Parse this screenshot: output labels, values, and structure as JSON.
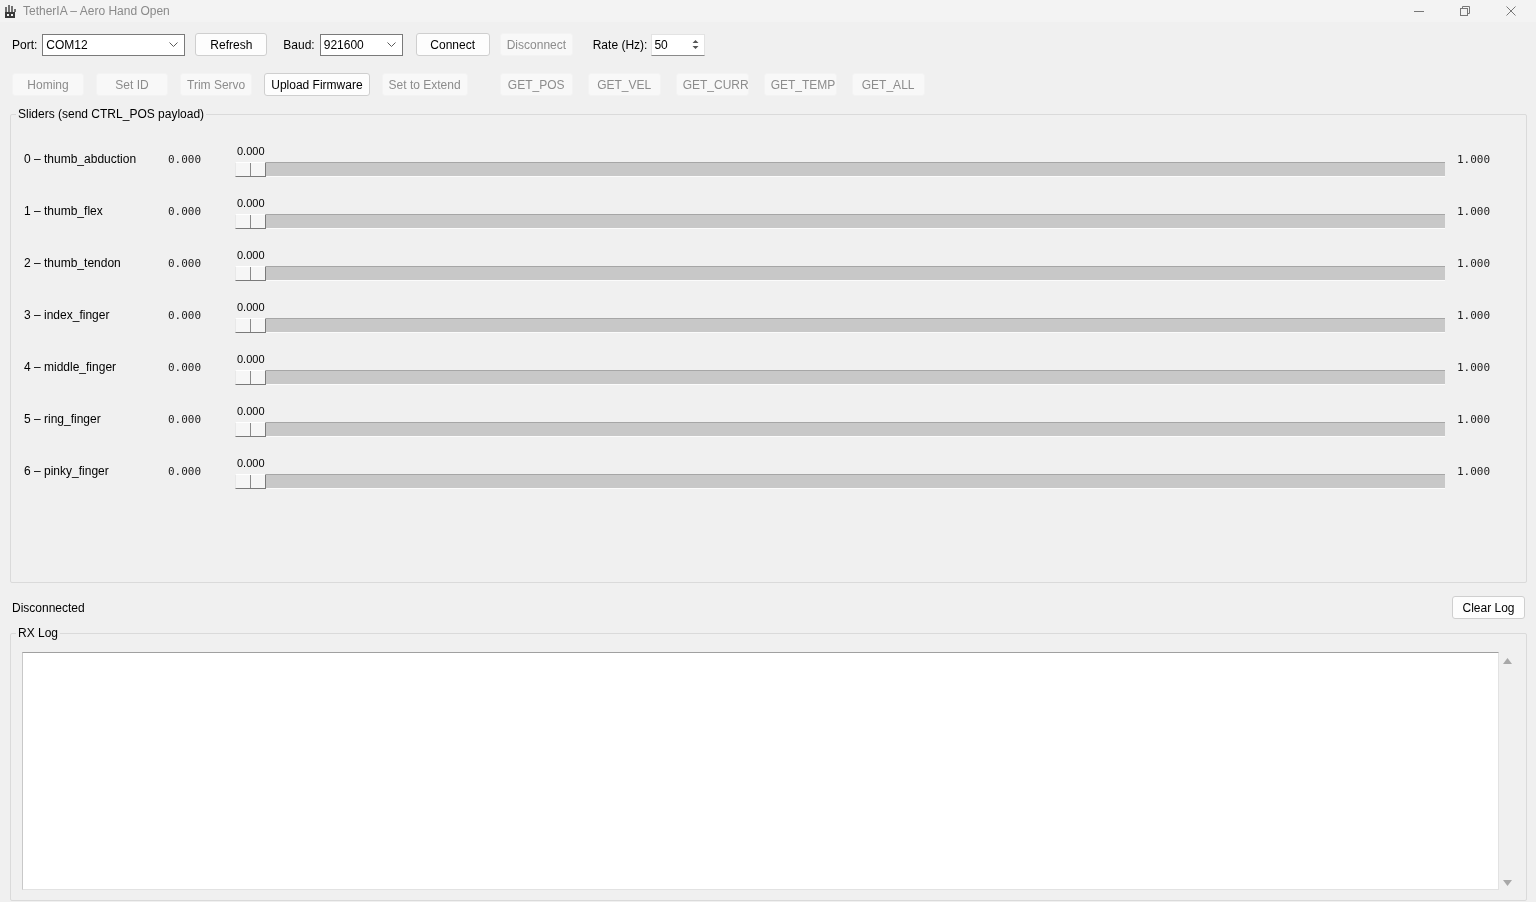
{
  "window": {
    "title": "TetherIA – Aero Hand Open"
  },
  "connection": {
    "port": {
      "label": "Port:",
      "value": "COM12"
    },
    "refresh": {
      "label": "Refresh",
      "disabled": false
    },
    "baud": {
      "label": "Baud:",
      "value": "921600"
    },
    "connect": {
      "label": "Connect",
      "disabled": false
    },
    "disconnect": {
      "label": "Disconnect",
      "disabled": true
    },
    "rate": {
      "label": "Rate (Hz):",
      "value": "50"
    }
  },
  "actions": [
    {
      "label": "Homing",
      "disabled": true
    },
    {
      "label": "Set ID",
      "disabled": true
    },
    {
      "label": "Trim Servo",
      "disabled": true
    },
    {
      "label": "Upload Firmware",
      "disabled": false
    },
    {
      "label": "Set to Extend",
      "disabled": true
    }
  ],
  "queries": [
    {
      "label": "GET_POS",
      "disabled": true
    },
    {
      "label": "GET_VEL",
      "disabled": true
    },
    {
      "label": "GET_CURR",
      "disabled": true
    },
    {
      "label": "GET_TEMP",
      "disabled": true
    },
    {
      "label": "GET_ALL",
      "disabled": true
    }
  ],
  "sliders": {
    "title": "Sliders (send CTRL_POS payload)",
    "items": [
      {
        "name": "0 – thumb_abduction",
        "reading": "0.000",
        "value_label": "0.000",
        "max_label": "1.000",
        "level": 0
      },
      {
        "name": "1 – thumb_flex",
        "reading": "0.000",
        "value_label": "0.000",
        "max_label": "1.000",
        "level": 0
      },
      {
        "name": "2 – thumb_tendon",
        "reading": "0.000",
        "value_label": "0.000",
        "max_label": "1.000",
        "level": 0
      },
      {
        "name": "3 – index_finger",
        "reading": "0.000",
        "value_label": "0.000",
        "max_label": "1.000",
        "level": 0
      },
      {
        "name": "4 – middle_finger",
        "reading": "0.000",
        "value_label": "0.000",
        "max_label": "1.000",
        "level": 0
      },
      {
        "name": "5 – ring_finger",
        "reading": "0.000",
        "value_label": "0.000",
        "max_label": "1.000",
        "level": 0
      },
      {
        "name": "6 – pinky_finger",
        "reading": "0.000",
        "value_label": "0.000",
        "max_label": "1.000",
        "level": 0
      }
    ]
  },
  "status": {
    "text": "Disconnected"
  },
  "clear_log": {
    "label": "Clear Log",
    "disabled": false
  },
  "rx_log": {
    "title": "RX Log"
  }
}
